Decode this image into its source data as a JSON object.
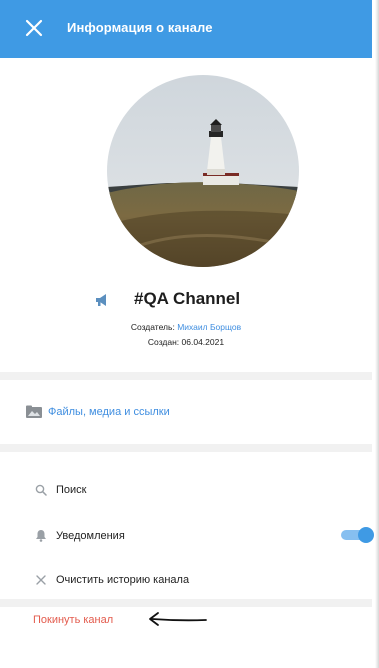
{
  "header": {
    "title": "Информация о канале",
    "close_icon": "close-icon",
    "color": "#3f9ae4"
  },
  "channel": {
    "name": "#QA Channel",
    "channel_icon": "megaphone-icon",
    "avatar": "lighthouse-photo",
    "creator_label": "Создатель:",
    "creator_name": "Михаил Борщов",
    "created_label": "Создан:",
    "created_date": "06.04.2021"
  },
  "files": {
    "label": "Файлы, медиа и ссылки",
    "icon": "media-folder-icon"
  },
  "menu": {
    "search_label": "Поиск",
    "search_icon": "search-icon",
    "notifications_label": "Уведомления",
    "notifications_icon": "bell-icon",
    "notifications_enabled": true,
    "clear_label": "Очистить историю канала",
    "clear_icon": "close-icon"
  },
  "leave": {
    "label": "Покинуть канал",
    "color": "#e35b4d",
    "annotation_icon": "arrow-left-icon"
  },
  "colors": {
    "accent": "#3f9ae4",
    "link": "#3f8ee0",
    "danger": "#e35b4d"
  }
}
